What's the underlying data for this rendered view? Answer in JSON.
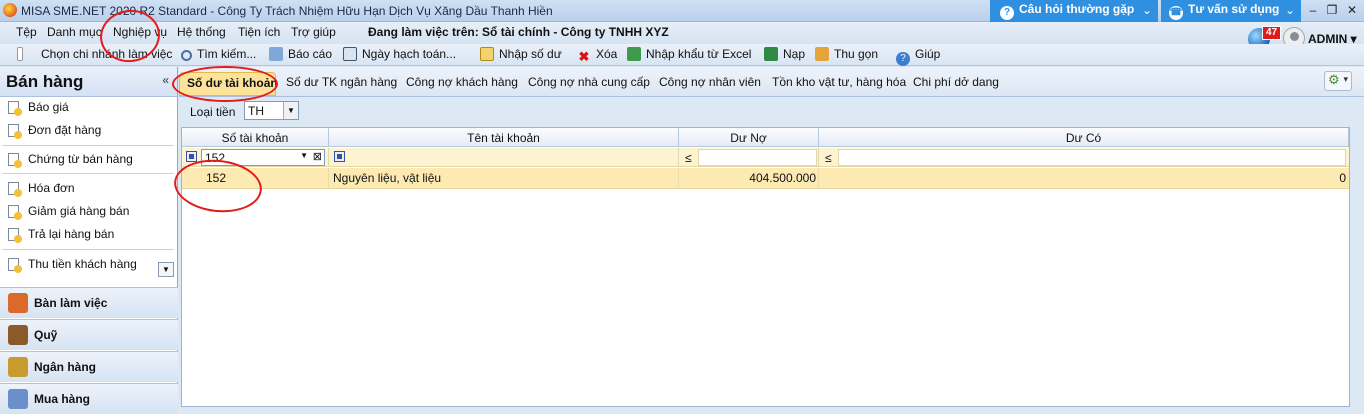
{
  "window": {
    "title": "MISA SME.NET 2020 R2 Standard - Công Ty Trách Nhiệm Hữu Hạn Dịch Vụ Xăng Dầu Thanh Hiền",
    "faq_label": "Câu hỏi thường gặp",
    "support_label": "Tư vấn sử dụng",
    "notification_count": "47",
    "user": "ADMIN"
  },
  "menu": {
    "items": [
      "Tệp",
      "Danh mục",
      "Nghiệp vụ",
      "Hệ thống",
      "Tiện ích",
      "Trợ giúp"
    ],
    "working_on": "Đang làm việc trên: Sổ tài chính - Công ty TNHH XYZ"
  },
  "toolbar": {
    "branch": "Chọn chi nhánh làm việc",
    "search": "Tìm kiếm...",
    "report": "Báo cáo",
    "posting_date": "Ngày hạch toán...",
    "enter_balance": "Nhập số dư",
    "delete": "Xóa",
    "import_excel": "Nhập khẩu từ Excel",
    "load": "Nạp",
    "collapse": "Thu gọn",
    "help": "Giúp"
  },
  "sidebar": {
    "title": "Bán hàng",
    "collapse_glyph": "«",
    "items": [
      "Báo giá",
      "Đơn đặt hàng",
      "Chứng từ bán hàng",
      "Hóa đơn",
      "Giảm giá hàng bán",
      "Trả lại hàng bán",
      "Thu tiền khách hàng"
    ],
    "modules": [
      "Bàn làm việc",
      "Quỹ",
      "Ngân hàng",
      "Mua hàng"
    ]
  },
  "tabs": [
    "Số dư tài khoản",
    "Số dư TK ngân hàng",
    "Công nợ khách hàng",
    "Công nợ nhà cung cấp",
    "Công nợ nhân viên",
    "Tồn kho vật tư, hàng hóa",
    "Chi phí dở dang"
  ],
  "currency": {
    "label": "Loại tiền",
    "value": "TH"
  },
  "grid": {
    "columns": [
      "Số tài khoản",
      "Tên tài khoản",
      "Dư Nợ",
      "Dư Có"
    ],
    "filter": {
      "account": "152",
      "debit_op": "≤",
      "credit_op": "≤"
    },
    "rows": [
      {
        "account": "152",
        "name": "Nguyên liệu, vật liệu",
        "debit": "404.500.000",
        "credit": "0"
      }
    ]
  },
  "colors": {
    "active_tab": "#fde39a",
    "selected_row": "#fde9b2",
    "filter_row": "#fcf3d1",
    "title_accent": "#2f8fe0",
    "annotation": "#e31b1b"
  }
}
